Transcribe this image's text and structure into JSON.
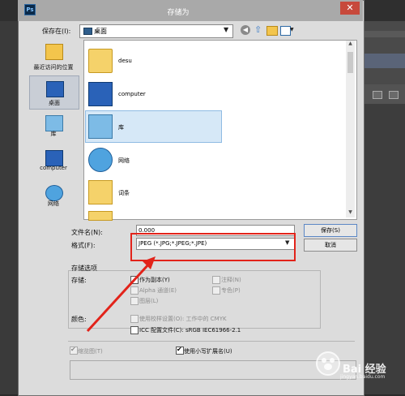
{
  "dialog": {
    "title": "存储为",
    "app_icon_text": "Ps",
    "close_label": "✕"
  },
  "toolbar": {
    "save_in_label": "保存在(I):",
    "save_in_value": "桌面"
  },
  "places": [
    {
      "label": "最近访问的位置"
    },
    {
      "label": "桌面"
    },
    {
      "label": "库"
    },
    {
      "label": "computer"
    },
    {
      "label": "网络"
    }
  ],
  "files": [
    {
      "label": "desu"
    },
    {
      "label": "computer"
    },
    {
      "label": "库"
    },
    {
      "label": "网络"
    },
    {
      "label": "词条"
    }
  ],
  "form": {
    "filename_label": "文件名(N):",
    "filename_value": "0.000",
    "format_label": "格式(F):",
    "format_value": "JPEG (*.JPG;*.JPEG;*.JPE)",
    "save_button": "保存(S)",
    "cancel_button": "取消"
  },
  "options": {
    "title": "存储选项",
    "store_label": "存储:",
    "as_copy": "作为副本(Y)",
    "alpha": "Alpha 通道(E)",
    "layers": "图层(L)",
    "annotations": "注释(N)",
    "spot": "专色(P)",
    "color_label": "颜色:",
    "proof": "使用校样设置(O): 工作中的 CMYK",
    "icc": "ICC 配置文件(C): sRGB IEC61966-2.1",
    "thumbnail": "缩览图(T)",
    "lowercase_ext": "使用小写扩展名(U)"
  },
  "watermark": {
    "brand": "Bai 经验",
    "url": "jingyan.baidu.com"
  },
  "colors": {
    "annotation_red": "#e2231a",
    "title_bar": "#a9a9a9",
    "close_red": "#c7493b"
  }
}
